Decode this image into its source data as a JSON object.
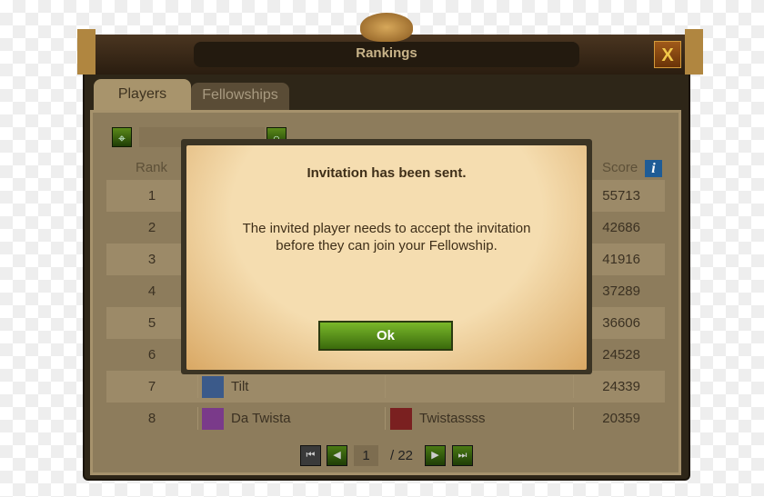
{
  "window": {
    "title": "Rankings",
    "close_label": "X"
  },
  "tabs": [
    {
      "label": "Players",
      "active": true
    },
    {
      "label": "Fellowships",
      "active": false
    }
  ],
  "headers": {
    "rank": "Rank",
    "score": "Score",
    "info": "i"
  },
  "rows": [
    {
      "rank": "1",
      "name": "",
      "fellowship": "",
      "score": "55713"
    },
    {
      "rank": "2",
      "name": "",
      "fellowship": "",
      "score": "42686"
    },
    {
      "rank": "3",
      "name": "",
      "fellowship": "",
      "score": "41916"
    },
    {
      "rank": "4",
      "name": "",
      "fellowship": "",
      "score": "37289"
    },
    {
      "rank": "5",
      "name": "",
      "fellowship": "",
      "score": "36606"
    },
    {
      "rank": "6",
      "name": "",
      "fellowship": "",
      "score": "24528"
    },
    {
      "rank": "7",
      "name": "Tilt",
      "fellowship": "",
      "score": "24339"
    },
    {
      "rank": "8",
      "name": "Da Twista",
      "fellowship": "Twistassss",
      "score": "20359"
    }
  ],
  "pagination": {
    "current": "1",
    "total": "/ 22"
  },
  "modal": {
    "title": "Invitation has been sent.",
    "line1": "The invited player needs to accept the invitation",
    "line2": "before they can join your Fellowship.",
    "ok_label": "Ok"
  }
}
